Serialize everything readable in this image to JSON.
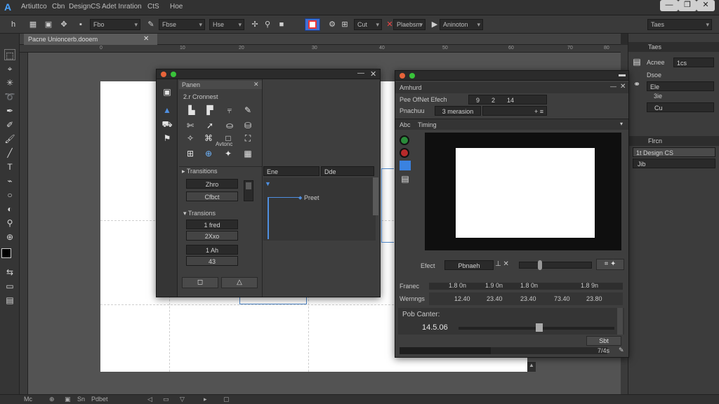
{
  "menubar": {
    "logo": "A",
    "items": [
      "Artiuttco",
      "Cbn",
      "DesignCS",
      "Adet Inration",
      "CtS",
      "Hoe"
    ],
    "window_buttons": [
      "—",
      "❐",
      "✕"
    ]
  },
  "controlbar": {
    "dd1": "Fbo",
    "dd2": "Fbse",
    "dd3": "Hse",
    "field_cut": "Cut",
    "position_label": "Plaebsm",
    "animation_label": "Aninoton"
  },
  "document": {
    "tab_label": "Pacne Unioncerb.dooem"
  },
  "ruler_ticks": [
    "0",
    "10",
    "20",
    "30",
    "40",
    "50",
    "60",
    "70",
    "80"
  ],
  "dock": {
    "head1": "Taes",
    "row1_label": "Acnee",
    "row1_value": "1cs",
    "row2": "Dsoe",
    "row3": "Ele",
    "row4": "3ie",
    "row5": "Cu",
    "head2": "Flrcn",
    "item_selected": "1t Design CS",
    "item2": "Jib"
  },
  "motion_panel": {
    "title": "Panen",
    "section_label": "2.r Cronnest",
    "icon_caption": "Avtonc",
    "transitions_label": "Transitions",
    "field1": "Zhro",
    "field2": "Cfbct",
    "transitions2_label": "Transions",
    "field3": "1 fred",
    "field4": "2Xxo",
    "field5": "1 Ah",
    "field6": "43",
    "timeline_col1": "Ene",
    "timeline_col2": "Dde",
    "preset_label": "Preet"
  },
  "animation_panel": {
    "title": "Amhurd",
    "row1_label": "Pee OfNet Efech",
    "row1_v1": "9",
    "row1_v2": "2",
    "row1_v3": "14",
    "row2_label": "Pnachuu",
    "row2_value": "3 merasion",
    "tab1": "Abc",
    "tab2": "Timing",
    "effect_label": "Efect",
    "effect_value": "Pbnaeh",
    "frame_label": "Franec",
    "frame_vals": [
      "1.8 0n",
      "1.9 0n",
      "1.8 0n",
      "1.8 9n"
    ],
    "warnings_label": "Wernngs",
    "warn_vals": [
      "12.40",
      "23.40",
      "23.40",
      "73.40",
      "23.80"
    ],
    "center_label": "Pob Canter:",
    "center_value": "14.5.06",
    "button_label": "Sbt",
    "bottom_label": "7/4s"
  }
}
